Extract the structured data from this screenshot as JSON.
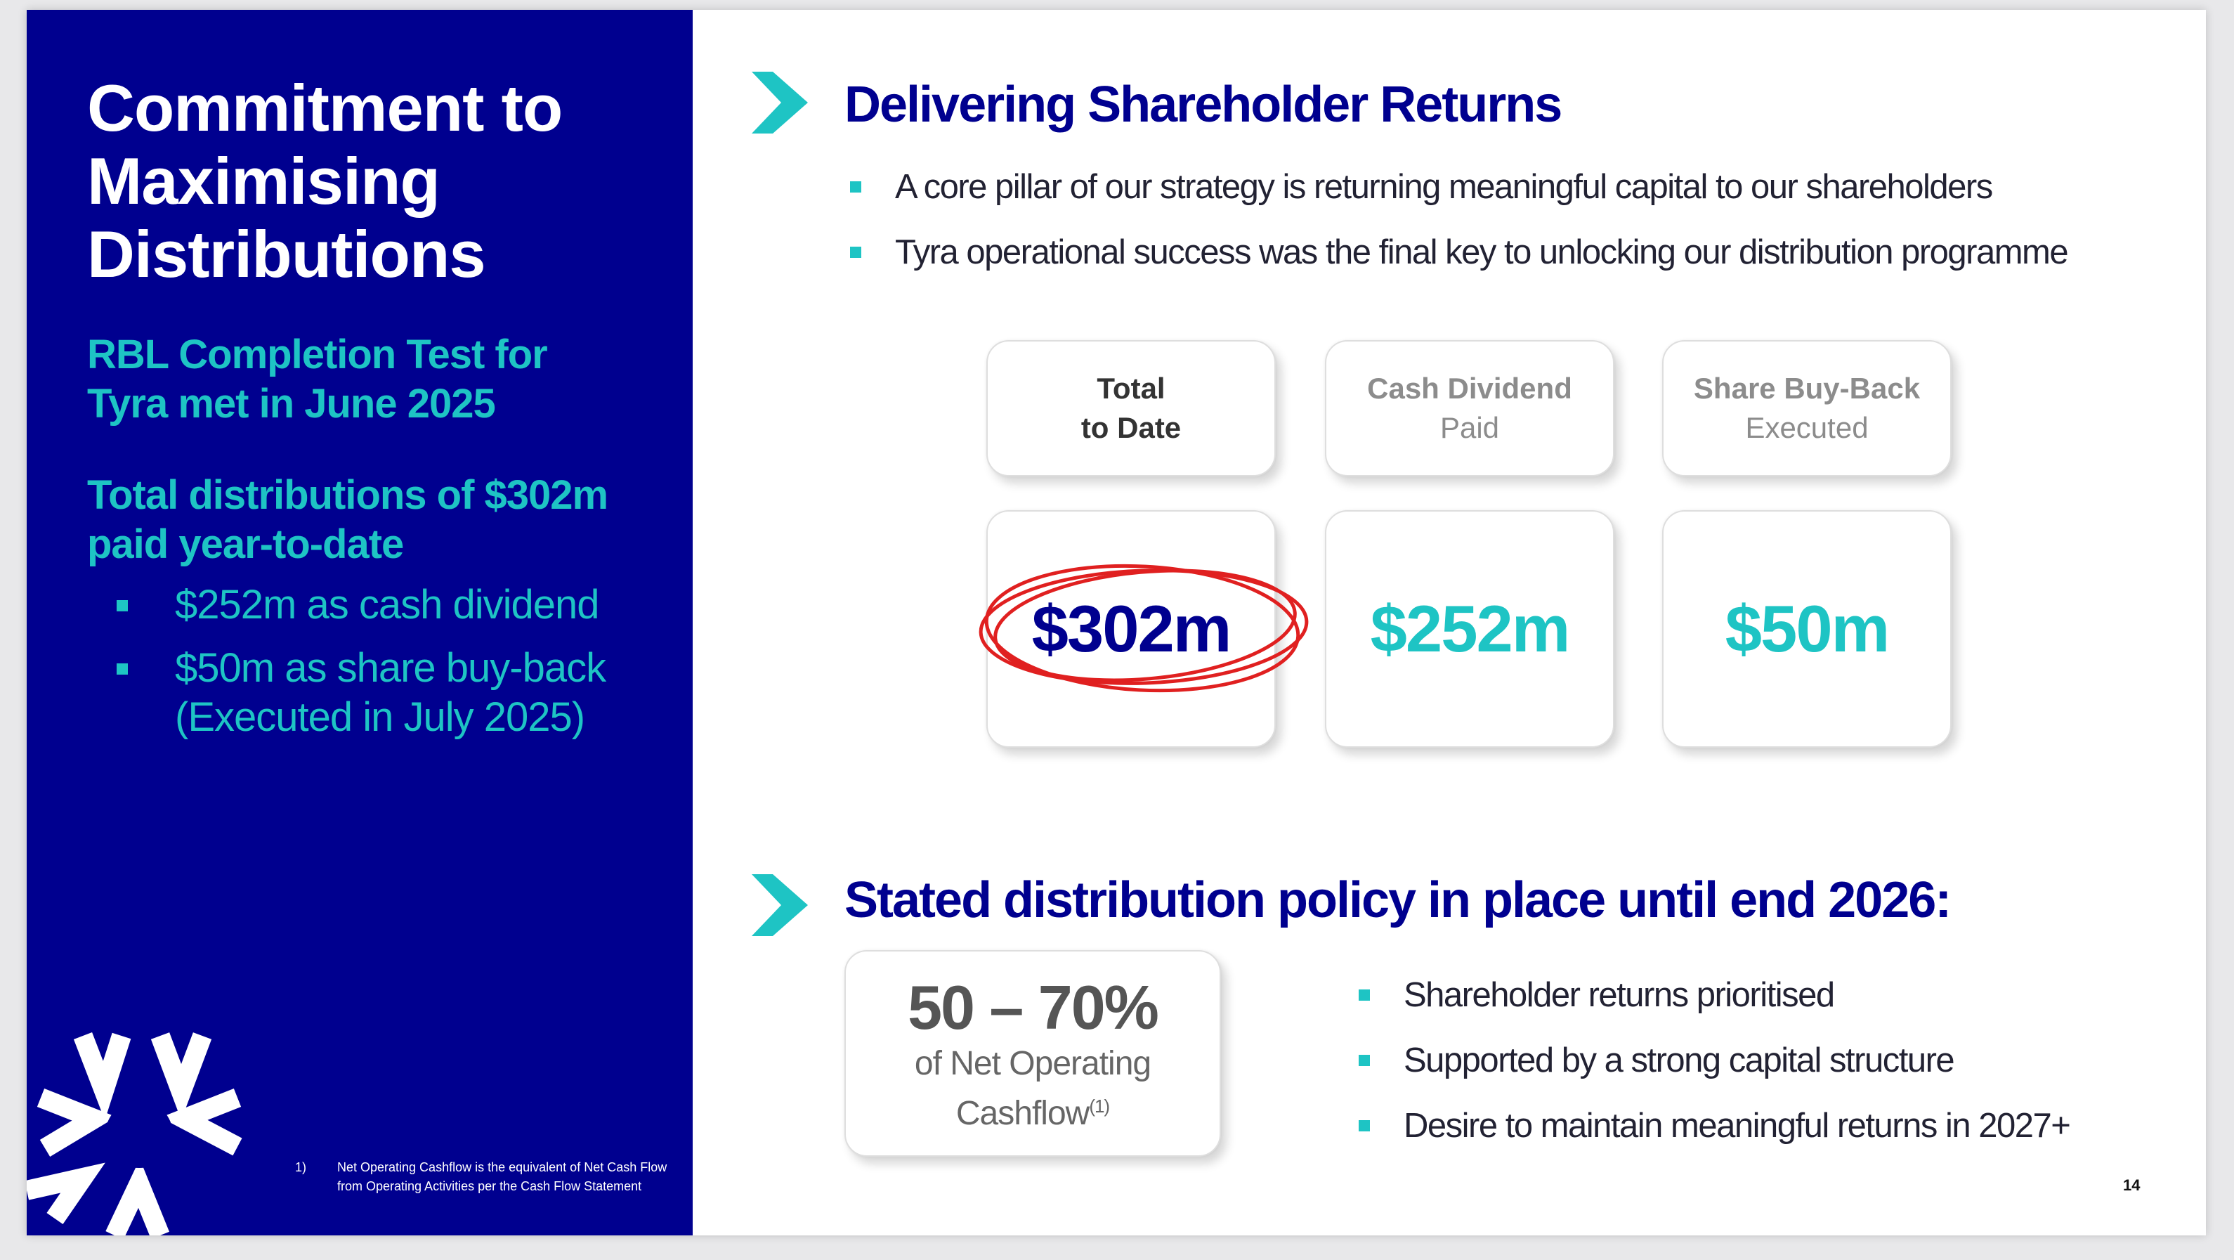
{
  "left_panel": {
    "title_lines": [
      "Commitment to",
      "Maximising",
      "Distributions"
    ],
    "rbl_heading_lines": [
      "RBL Completion Test for",
      "Tyra met in June 2025"
    ],
    "distributions_heading_lines": [
      "Total distributions of $302m",
      "paid year-to-date"
    ],
    "bullets": [
      {
        "lines": [
          "$252m as cash dividend"
        ]
      },
      {
        "lines": [
          "$50m as share buy-back",
          "(Executed in July 2025)"
        ]
      }
    ],
    "footnote": {
      "number": "1)",
      "text": "Net Operating Cashflow is the equivalent of Net Cash Flow from Operating Activities per the Cash Flow Statement"
    },
    "logo_icon": "starburst-logo-icon"
  },
  "section1": {
    "icon": "chevron-right-icon",
    "title": "Delivering Shareholder Returns",
    "bullets": [
      "A core pillar of our strategy is returning meaningful capital to our shareholders",
      "Tyra operational success was the final key to unlocking our distribution programme"
    ]
  },
  "cards": [
    {
      "label_top": "Total",
      "label_bottom": "to Date",
      "value": "$302m",
      "highlighted": true
    },
    {
      "label_top": "Cash Dividend",
      "label_bottom": "Paid",
      "value": "$252m",
      "highlighted": false
    },
    {
      "label_top": "Share Buy-Back",
      "label_bottom": "Executed",
      "value": "$50m",
      "highlighted": false
    }
  ],
  "section2": {
    "icon": "chevron-right-icon",
    "title": "Stated distribution policy in place until end 2026:",
    "policy": {
      "range": "50 – 70%",
      "desc_line1": "of Net Operating",
      "desc_line2": "Cashflow",
      "footnote_ref": "(1)"
    },
    "bullets": [
      "Shareholder returns prioritised",
      "Supported by a strong capital structure",
      "Desire to maintain meaningful returns in 2027+"
    ]
  },
  "page_number": "14",
  "colors": {
    "navy": "#00008f",
    "teal": "#1ec4c4",
    "highlight": "#e02020"
  }
}
